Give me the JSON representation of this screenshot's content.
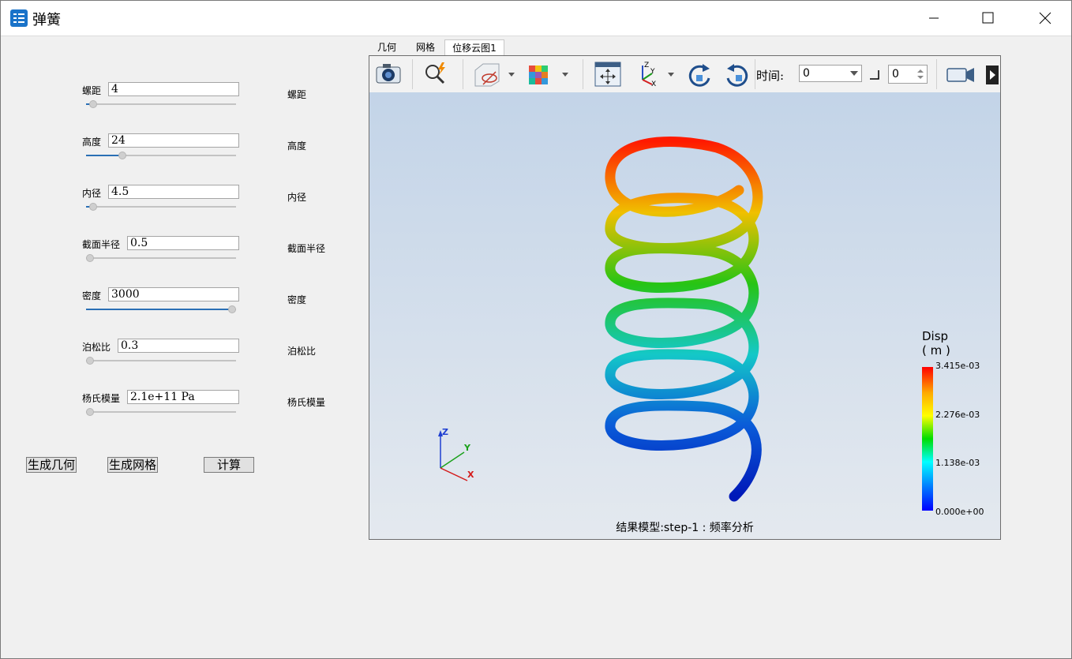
{
  "window": {
    "title": "弹簧",
    "min_label": "—",
    "max_label": "☐",
    "close_label": "✕"
  },
  "params": [
    {
      "label": "螺距",
      "value": "4",
      "side_label": "螺距",
      "slider_fraction": 0.02
    },
    {
      "label": "高度",
      "value": "24",
      "side_label": "高度",
      "slider_fraction": 0.23
    },
    {
      "label": "内径",
      "value": "4.5",
      "side_label": "内径",
      "slider_fraction": 0.02
    },
    {
      "label": "截面半径",
      "value": "0.5",
      "side_label": "截面半径",
      "slider_fraction": 0.0
    },
    {
      "label": "密度",
      "value": "3000",
      "side_label": "密度",
      "slider_fraction": 1.0
    },
    {
      "label": "泊松比",
      "value": "0.3",
      "side_label": "泊松比",
      "slider_fraction": 0.0
    },
    {
      "label": "杨氏模量",
      "value": "2.1e+11 Pa",
      "side_label": "杨氏模量",
      "slider_fraction": 0.0
    }
  ],
  "buttons": {
    "gen_geometry": "生成几何",
    "gen_mesh": "生成网格",
    "compute": "计算"
  },
  "tabs": [
    "几何",
    "网格",
    "位移云图1"
  ],
  "toolbar": {
    "time_label": "时间:",
    "time_value": "0",
    "step_value": "0",
    "icons": [
      "camera-icon",
      "zoom-lightning-icon",
      "box-visibility-icon",
      "cube-color-icon",
      "fit-view-icon",
      "axes-xyz-icon",
      "rotate-cw-icon",
      "rotate-ccw-icon",
      "video-camera-icon"
    ]
  },
  "viewer": {
    "caption": "结果模型:step-1 : 频率分析",
    "legend": {
      "title": "Disp",
      "unit": "( m )",
      "values": [
        "3.415e-03",
        "2.276e-03",
        "1.138e-03",
        "0.000e+00"
      ]
    },
    "axes_labels": {
      "x": "X",
      "y": "Y",
      "z": "Z"
    }
  }
}
